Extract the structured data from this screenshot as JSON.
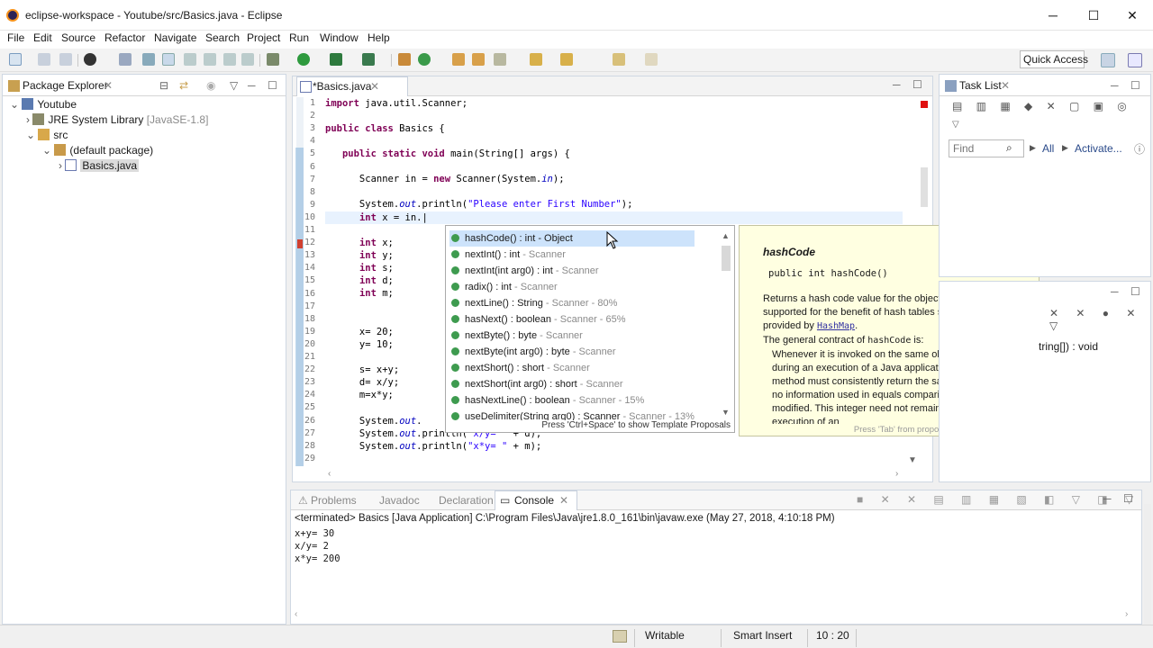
{
  "window": {
    "title": "eclipse-workspace - Youtube/src/Basics.java - Eclipse"
  },
  "menu": [
    "File",
    "Edit",
    "Source",
    "Refactor",
    "Navigate",
    "Search",
    "Project",
    "Run",
    "Window",
    "Help"
  ],
  "toolbar": {
    "quick_access": "Quick Access"
  },
  "package_explorer": {
    "tab": "Package Explorer",
    "tree": [
      "Youtube",
      "JRE System Library",
      "[JavaSE-1.8]",
      "src",
      "(default package)",
      "Basics.java"
    ]
  },
  "editor": {
    "tab": "*Basics.java",
    "line_numbers": [
      "1",
      "2",
      "3",
      "4",
      "5",
      "6",
      "7",
      "8",
      "9",
      "10",
      "11",
      "12",
      "13",
      "14",
      "15",
      "16",
      "17",
      "18",
      "19",
      "20",
      "21",
      "22",
      "23",
      "24",
      "25",
      "26",
      "27",
      "28",
      "29"
    ]
  },
  "completion": {
    "items": [
      {
        "main": "hashCode() : int - Object",
        "extra": ""
      },
      {
        "main": "nextInt() : int",
        "extra": " - Scanner"
      },
      {
        "main": "nextInt(int arg0) : int",
        "extra": " - Scanner"
      },
      {
        "main": "radix() : int",
        "extra": " - Scanner"
      },
      {
        "main": "nextLine() : String",
        "extra": " - Scanner - 80%"
      },
      {
        "main": "hasNext() : boolean",
        "extra": " - Scanner - 65%"
      },
      {
        "main": "nextByte() : byte",
        "extra": " - Scanner"
      },
      {
        "main": "nextByte(int arg0) : byte",
        "extra": " - Scanner"
      },
      {
        "main": "nextShort() : short",
        "extra": " - Scanner"
      },
      {
        "main": "nextShort(int arg0) : short",
        "extra": " - Scanner"
      },
      {
        "main": "hasNextLine() : boolean",
        "extra": " - Scanner - 15%"
      },
      {
        "main": "useDelimiter(String arg0) : Scanner",
        "extra": " - Scanner - 13%"
      }
    ],
    "hint": "Press 'Ctrl+Space' to show Template Proposals"
  },
  "javadoc": {
    "heading": "hashCode",
    "signature": "public int hashCode()",
    "para1": "Returns a hash code value for the object. This method is supported for the benefit of hash tables such as those provided by",
    "link": "HashMap",
    "para2_pre": "The general contract of",
    "para2_code": "hashCode",
    "para2_post": "is:",
    "bullet": "Whenever it is invoked on the same object more than once during an execution of a Java application, the hashCode method must consistently return the same integer, provided no information used in equals comparisons on the object is modified. This integer need not remain consistent from one execution of an",
    "footer": "Press 'Tab' from proposal table or click for focus"
  },
  "task_list": {
    "tab": "Task List",
    "find_placeholder": "Find",
    "all": "All",
    "activate": "Activate...",
    "outline_text": "tring[]) : void"
  },
  "console": {
    "tabs": [
      "Problems",
      "Javadoc",
      "Declaration",
      "Console"
    ],
    "header": "<terminated> Basics [Java Application] C:\\Program Files\\Java\\jre1.8.0_161\\bin\\javaw.exe (May 27, 2018, 4:10:18 PM)",
    "lines": [
      "x+y= 30",
      "x/y= 2",
      "x*y= 200"
    ]
  },
  "status": {
    "writable": "Writable",
    "insert": "Smart Insert",
    "position": "10 : 20"
  },
  "colors": {
    "keyword": "#7f0055",
    "string": "#2a00ff",
    "field": "#0000c0",
    "selection": "#cde3fb",
    "javadoc_bg": "#ffffe1"
  }
}
